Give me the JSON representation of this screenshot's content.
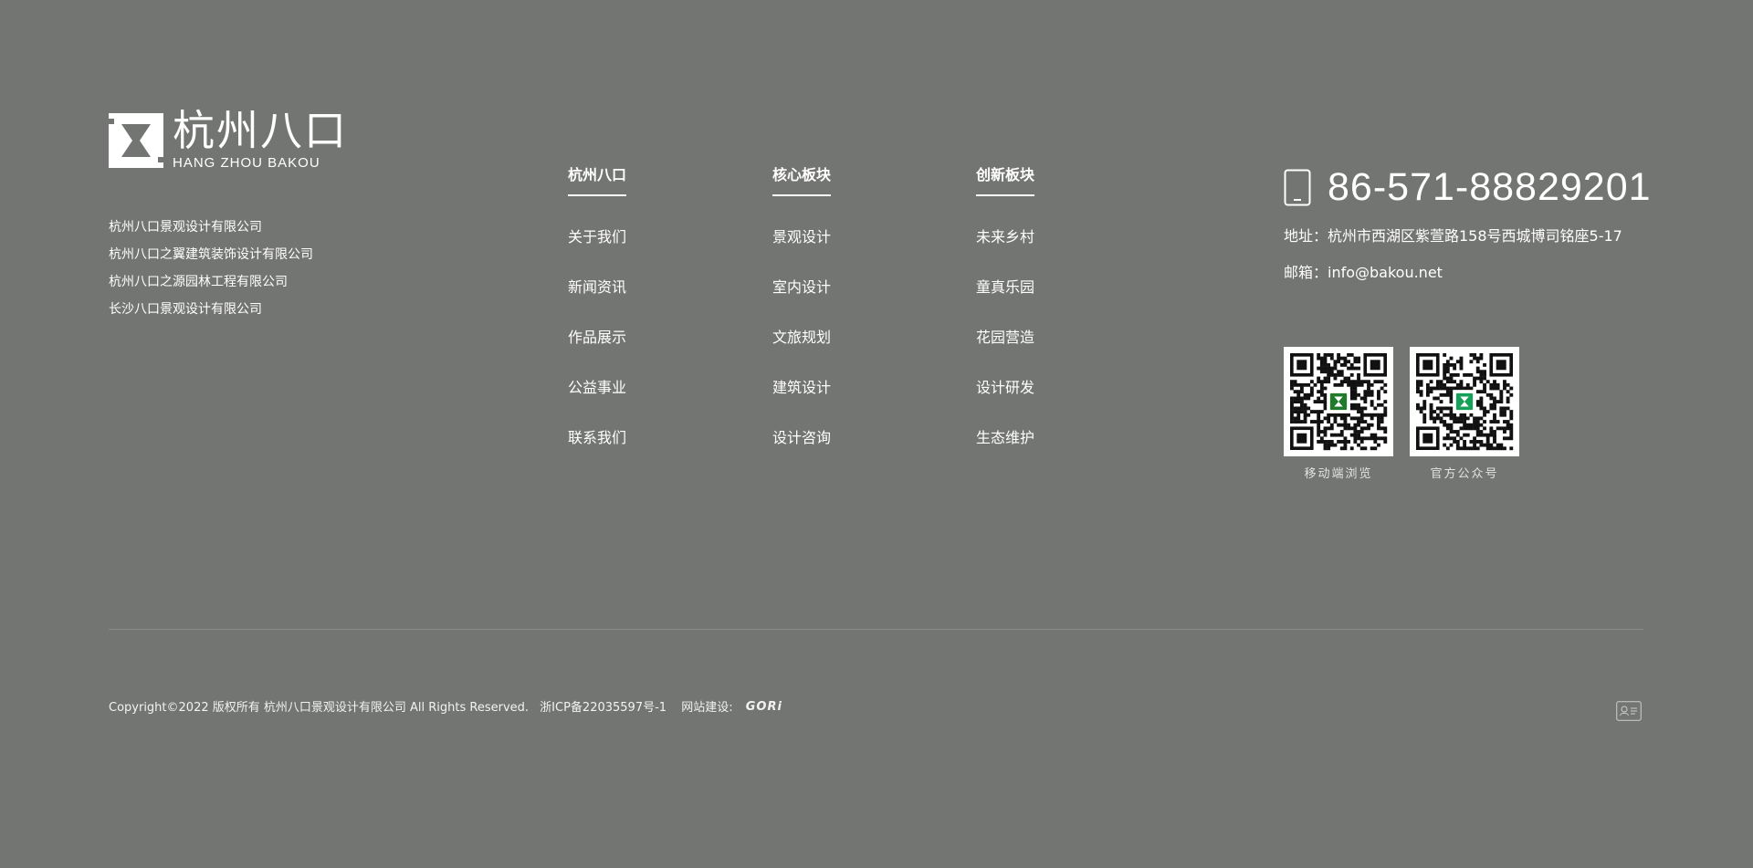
{
  "logo": {
    "cn": "杭州八口",
    "en": "HANG ZHOU BAKOU"
  },
  "companies": [
    "杭州八口景观设计有限公司",
    "杭州八口之翼建筑装饰设计有限公司",
    "杭州八口之源园林工程有限公司",
    "长沙八口景观设计有限公司"
  ],
  "nav": [
    {
      "heading": "杭州八口",
      "items": [
        "关于我们",
        "新闻资讯",
        "作品展示",
        "公益事业",
        "联系我们"
      ]
    },
    {
      "heading": "核心板块",
      "items": [
        "景观设计",
        "室内设计",
        "文旅规划",
        "建筑设计",
        "设计咨询"
      ]
    },
    {
      "heading": "创新板块",
      "items": [
        "未来乡村",
        "童真乐园",
        "花园营造",
        "设计研发",
        "生态维护"
      ]
    }
  ],
  "contact": {
    "phone": "86-571-88829201",
    "address": "地址：杭州市西湖区紫萱路158号西城博司铭座5-17",
    "email": "邮箱：info@bakou.net"
  },
  "qrcodes": [
    {
      "caption": "移动端浏览",
      "center_color": "#1f7a2a"
    },
    {
      "caption": "官方公众号",
      "center_color": "#17a05a"
    }
  ],
  "copyright": {
    "text": "Copyright©2022 版权所有 杭州八口景观设计有限公司 All Rights Reserved.",
    "icp": "浙ICP备22035597号-1",
    "builder_label": "网站建设:",
    "builder_logo": "GORi"
  },
  "icons": {
    "phone": "mobile-phone-icon",
    "admin": "id-card-icon"
  },
  "colors": {
    "background": "#737572",
    "text": "#ffffff",
    "divider": "#8a8c89"
  }
}
